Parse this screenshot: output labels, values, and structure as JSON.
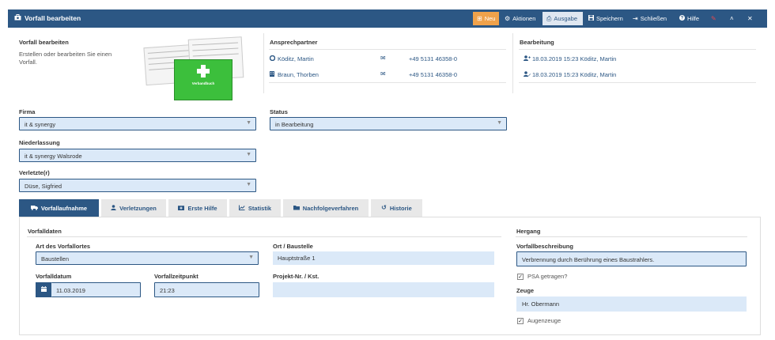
{
  "window": {
    "title": "Vorfall bearbeiten",
    "toolbar": {
      "neu": "Neu",
      "aktionen": "Aktionen",
      "ausgabe": "Ausgabe",
      "speichern": "Speichern",
      "schliessen": "Schließen",
      "hilfe": "Hilfe"
    }
  },
  "info": {
    "heading": "Vorfall bearbeiten",
    "description": "Erstellen oder bearbeiten Sie einen Vorfall.",
    "booklet_label": "Verbandbuch"
  },
  "contacts": {
    "heading": "Ansprechpartner",
    "items": [
      {
        "name": "Köditz, Martin",
        "phone": "+49 5131 46358-0"
      },
      {
        "name": "Braun, Thorben",
        "phone": "+49 5131 46358-0"
      }
    ]
  },
  "processing": {
    "heading": "Bearbeitung",
    "items": [
      {
        "text": "18.03.2019 15:23 Köditz, Martin"
      },
      {
        "text": "18.03.2019 15:23 Köditz, Martin"
      }
    ]
  },
  "form": {
    "firma_label": "Firma",
    "firma_value": "it & synergy",
    "niederlassung_label": "Niederlassung",
    "niederlassung_value": "it & synergy Walsrode",
    "verletzte_label": "Verletzte(r)",
    "verletzte_value": "Düse, Sigfried",
    "status_label": "Status",
    "status_value": "in Bearbeitung"
  },
  "tabs": [
    {
      "label": "Vorfallaufnahme"
    },
    {
      "label": "Verletzungen"
    },
    {
      "label": "Erste Hilfe"
    },
    {
      "label": "Statistik"
    },
    {
      "label": "Nachfolgeverfahren"
    },
    {
      "label": "Historie"
    }
  ],
  "vorfalldaten": {
    "heading": "Vorfalldaten",
    "art_label": "Art des Vorfallortes",
    "art_value": "Baustellen",
    "ort_label": "Ort / Baustelle",
    "ort_value": "Hauptstraße 1",
    "datum_label": "Vorfalldatum",
    "datum_value": "11.03.2019",
    "zeit_label": "Vorfallzeitpunkt",
    "zeit_value": "21:23",
    "projekt_label": "Projekt-Nr. / Kst.",
    "projekt_value": ""
  },
  "hergang": {
    "heading": "Hergang",
    "beschreibung_label": "Vorfallbeschreibung",
    "beschreibung_value": "Verbrennung durch Berührung eines Baustrahlers.",
    "psa_label": "PSA getragen?",
    "psa_checked": true,
    "zeuge_label": "Zeuge",
    "zeuge_value": "Hr. Obermann",
    "augenzeuge_label": "Augenzeuge",
    "augenzeuge_checked": true
  }
}
